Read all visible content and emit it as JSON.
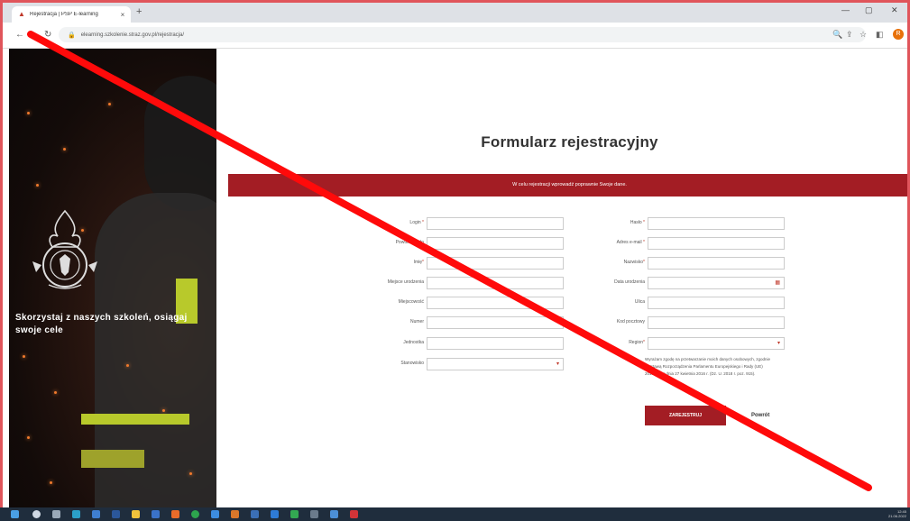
{
  "browser": {
    "tab_title": "Rejestracja | PSP E-learning",
    "tab_close": "×",
    "new_tab": "+",
    "url": "elearning.szkolenie.straz.gov.pl/rejestracja/",
    "win_minimize": "—",
    "win_restore": "▢",
    "win_close": "✕",
    "profile_initial": "R"
  },
  "hero": {
    "tagline": "Skorzystaj z naszych szkoleń, osiągaj swoje cele"
  },
  "form": {
    "title": "Formularz rejestracyjny",
    "banner": "W celu rejestracji wprowadź poprawnie Swoje dane.",
    "left_fields": [
      {
        "label": "Login",
        "required": "*"
      },
      {
        "label": "Powtórz hasło",
        "required": ""
      },
      {
        "label": "Imię",
        "required": "*"
      },
      {
        "label": "Miejsce urodzenia",
        "required": ""
      },
      {
        "label": "Miejscowość",
        "required": ""
      },
      {
        "label": "Numer",
        "required": ""
      },
      {
        "label": "Jednostka",
        "required": ""
      },
      {
        "label": "Stanowisko",
        "required": ""
      }
    ],
    "right_fields": [
      {
        "label": "Hasło",
        "required": "*"
      },
      {
        "label": "Adres e-mail",
        "required": "*"
      },
      {
        "label": "Nazwisko",
        "required": "*"
      },
      {
        "label": "Data urodzenia",
        "required": ""
      },
      {
        "label": "Ulica",
        "required": ""
      },
      {
        "label": "Kod pocztowy",
        "required": ""
      },
      {
        "label": "Region",
        "required": "*"
      }
    ],
    "consent": "Wyrażam zgodę na przetwarzanie moich danych osobowych, zgodnie z Ustawą Rozporządzenia Parlamentu Europejskiego i Rady (UE) 2016/679 z dnia 27 kwietnia 2016 r. (Dz. U. 2018 r. poz. 915).",
    "register_button": "ZAREJESTRUJ",
    "back_button": "Powrót"
  },
  "taskbar": {
    "time": "12:45",
    "date": "21.06.2022"
  },
  "colors": {
    "brand_red": "#a31d24",
    "annotation_red": "#ff0a0a"
  }
}
